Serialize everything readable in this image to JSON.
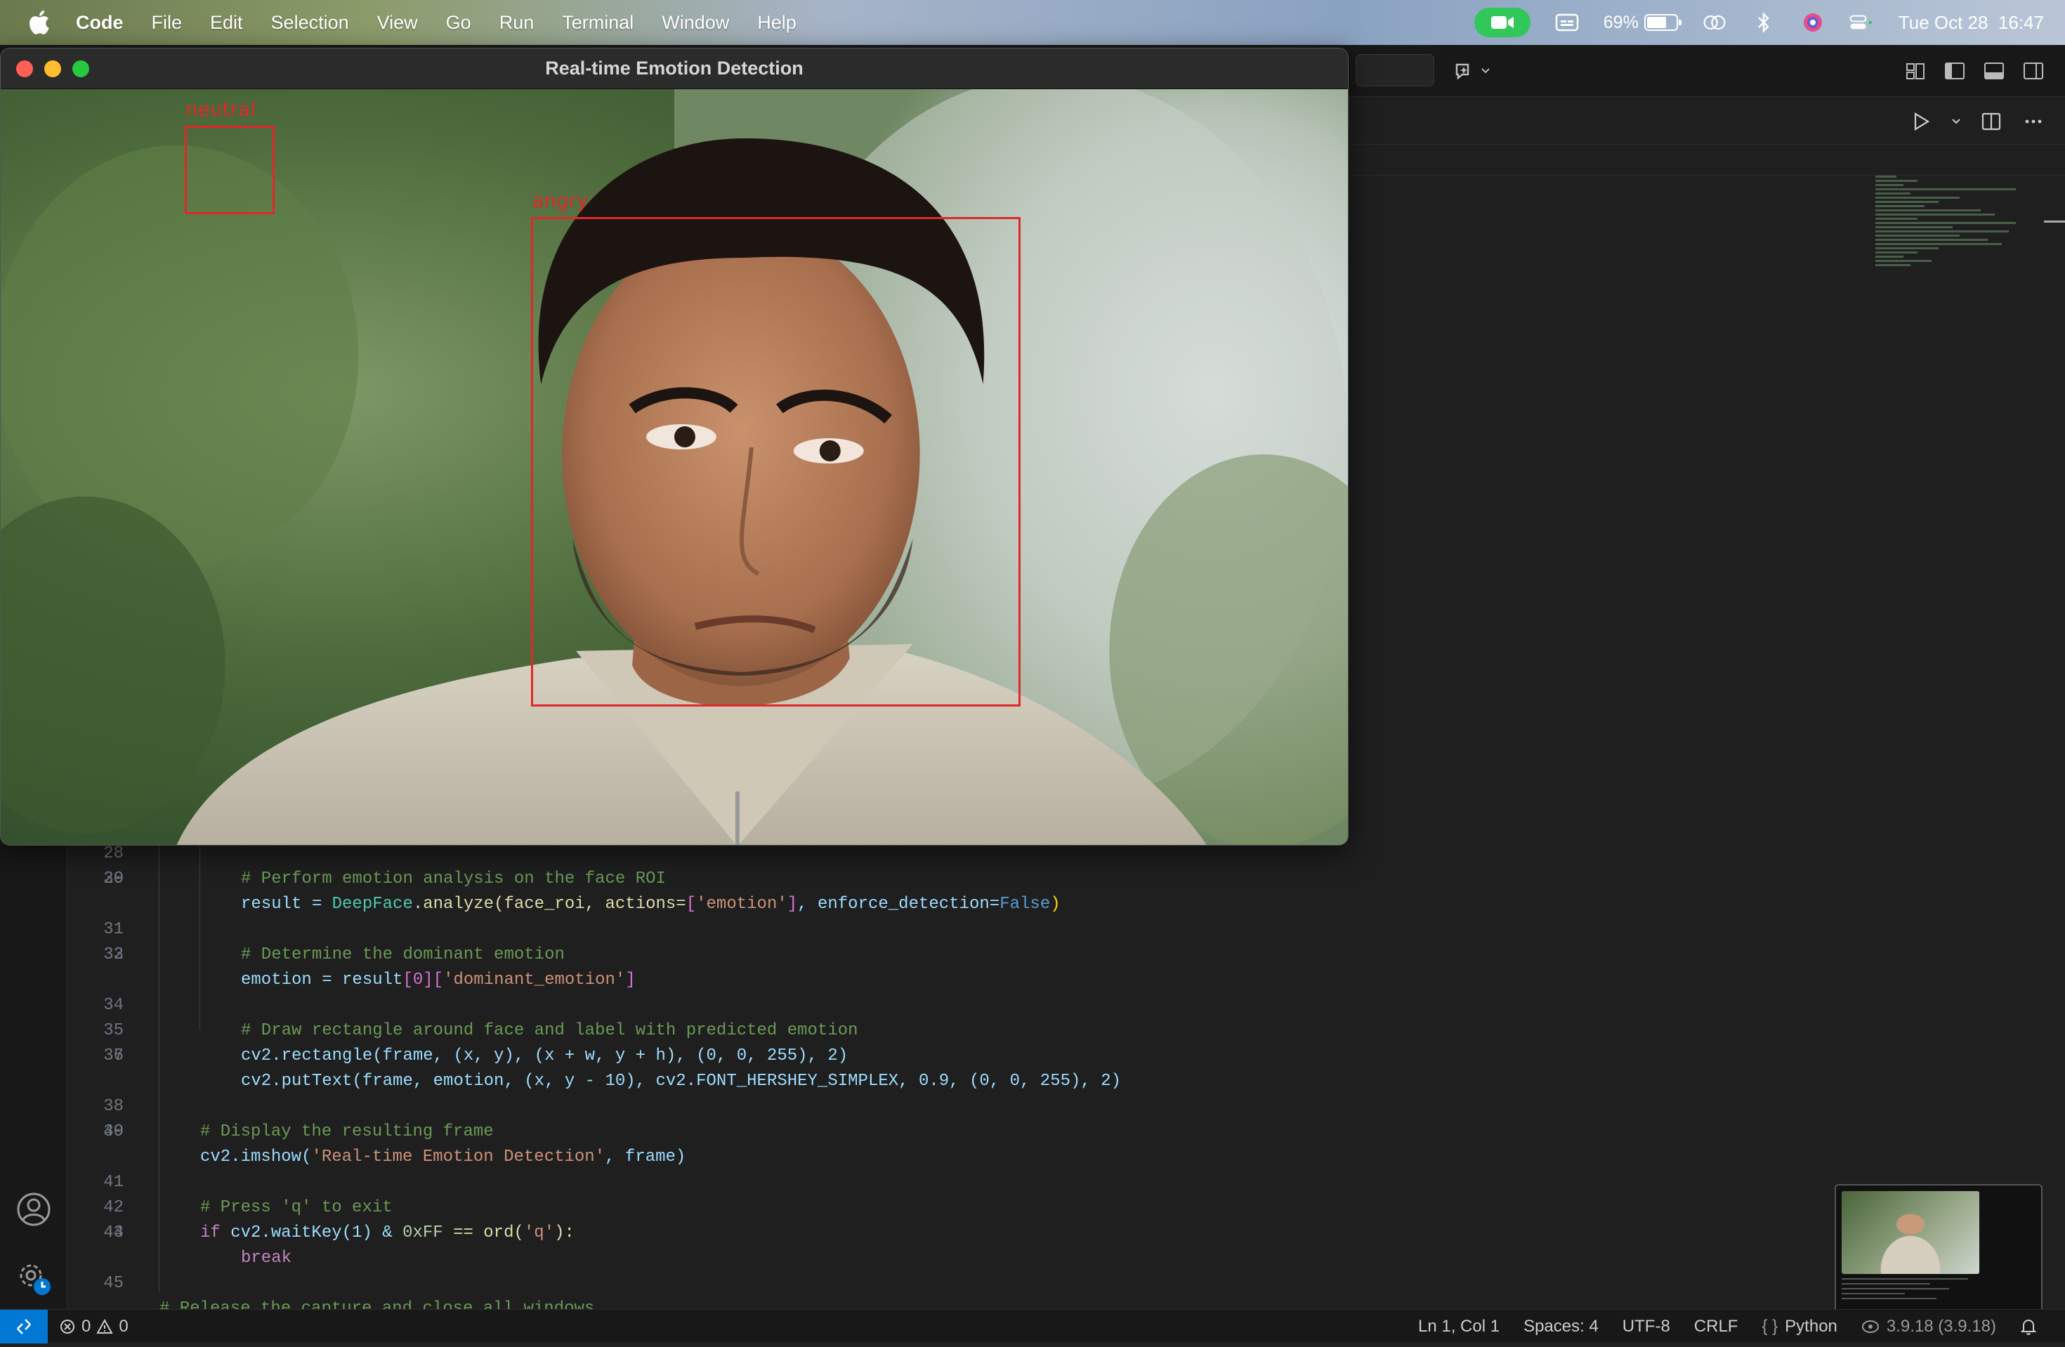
{
  "menubar": {
    "app_name": "Code",
    "items": [
      "File",
      "Edit",
      "Selection",
      "View",
      "Go",
      "Run",
      "Terminal",
      "Window",
      "Help"
    ],
    "battery_percent": "69%",
    "battery_level": 0.69,
    "datetime": "Tue Oct 28  16:47"
  },
  "cv_window": {
    "title": "Real-time Emotion Detection",
    "detections": [
      {
        "label": "neutral",
        "color": "#e0282a"
      },
      {
        "label": "angry",
        "color": "#e0282a"
      }
    ]
  },
  "editor": {
    "partial_first_line": "27",
    "lines": [
      {
        "n": "28"
      },
      {
        "n": "29"
      },
      {
        "n": "30"
      },
      {
        "n": "31"
      },
      {
        "n": "32"
      },
      {
        "n": "33"
      },
      {
        "n": "34"
      },
      {
        "n": "35"
      },
      {
        "n": "36"
      },
      {
        "n": "37"
      },
      {
        "n": "38"
      },
      {
        "n": "39"
      },
      {
        "n": "40"
      },
      {
        "n": "41"
      },
      {
        "n": "42"
      },
      {
        "n": "43"
      },
      {
        "n": "44"
      },
      {
        "n": "45"
      }
    ],
    "code": {
      "l28": "# Perform emotion analysis on the face ROI",
      "l29_a": "result = ",
      "l29_b": "DeepFace",
      "l29_c": ".analyze(face_roi, actions=",
      "l29_d": "[",
      "l29_e": "'emotion'",
      "l29_f": "]",
      "l29_g": ", enforce_detection=",
      "l29_h": "False",
      "l29_i": ")",
      "l31": "# Determine the dominant emotion",
      "l32_a": "emotion = result",
      "l32_b": "[0]",
      "l32_c": "[",
      "l32_d": "'dominant_emotion'",
      "l32_e": "]",
      "l34": "# Draw rectangle around face and label with predicted emotion",
      "l35": "cv2.rectangle(frame, (x, y), (x + w, y + h), (0, 0, 255), 2)",
      "l36": "cv2.putText(frame, emotion, (x, y - 10), cv2.FONT_HERSHEY_SIMPLEX, 0.9, (0, 0, 255), 2)",
      "l38": "# Display the resulting frame",
      "l39_a": "cv2.imshow(",
      "l39_b": "'Real-time Emotion Detection'",
      "l39_c": ", frame)",
      "l41": "# Press 'q' to exit",
      "l42_a": "if",
      "l42_b": " cv2.waitKey(1) & ",
      "l42_c": "0xFF",
      "l42_d": " == ord(",
      "l42_e": "'q'",
      "l42_f": "):",
      "l43": "break",
      "l45": "# Release the capture and close all windows"
    }
  },
  "statusbar": {
    "errors": "0",
    "warnings": "0",
    "cursor": "Ln 1, Col 1",
    "spaces": "Spaces: 4",
    "encoding": "UTF-8",
    "eol": "CRLF",
    "language": "Python",
    "interpreter": "3.9.18 (3.9.18)"
  },
  "colors": {
    "accent": "#0078d4",
    "detection_box": "#e0282a",
    "facetime_green": "#32c759"
  }
}
